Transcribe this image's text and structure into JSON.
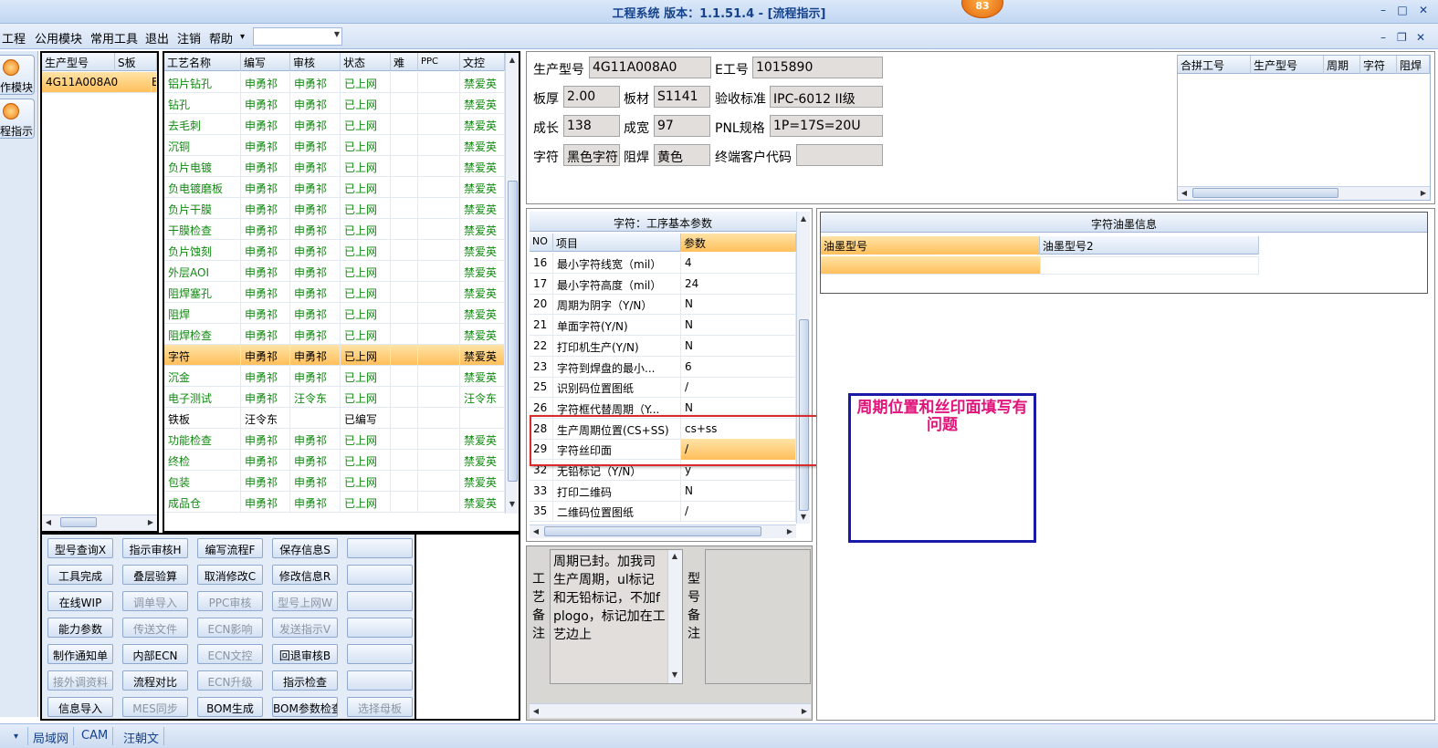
{
  "window": {
    "title": "工程系统  版本：1.1.51.4 - [流程指示]",
    "badge": "83",
    "min": "–",
    "max": "□",
    "close": "✕"
  },
  "menu": {
    "items": [
      "工程",
      "公用模块",
      "常用工具",
      "退出",
      "注销",
      "帮助"
    ],
    "help_arrow": "▾",
    "combo_value": "",
    "mdi_min": "–",
    "mdi_restore": "❐",
    "mdi_close": "✕"
  },
  "toolbox": {
    "items": [
      "作模块",
      "程指示"
    ]
  },
  "model_list": {
    "headers": [
      "生产型号",
      "S板"
    ],
    "rows": [
      [
        "4G11A008A0",
        "E"
      ]
    ]
  },
  "process_table": {
    "headers": [
      "工艺名称",
      "编写",
      "审核",
      "状态",
      "难",
      "PPC",
      "文控"
    ],
    "rows": [
      [
        "铝片钻孔",
        "申勇祁",
        "申勇祁",
        "已上网",
        "",
        "",
        "禁爱英"
      ],
      [
        "钻孔",
        "申勇祁",
        "申勇祁",
        "已上网",
        "",
        "",
        "禁爱英"
      ],
      [
        "去毛刺",
        "申勇祁",
        "申勇祁",
        "已上网",
        "",
        "",
        "禁爱英"
      ],
      [
        "沉铜",
        "申勇祁",
        "申勇祁",
        "已上网",
        "",
        "",
        "禁爱英"
      ],
      [
        "负片电镀",
        "申勇祁",
        "申勇祁",
        "已上网",
        "",
        "",
        "禁爱英"
      ],
      [
        "负电镀磨板",
        "申勇祁",
        "申勇祁",
        "已上网",
        "",
        "",
        "禁爱英"
      ],
      [
        "负片干膜",
        "申勇祁",
        "申勇祁",
        "已上网",
        "",
        "",
        "禁爱英"
      ],
      [
        "干膜检查",
        "申勇祁",
        "申勇祁",
        "已上网",
        "",
        "",
        "禁爱英"
      ],
      [
        "负片蚀刻",
        "申勇祁",
        "申勇祁",
        "已上网",
        "",
        "",
        "禁爱英"
      ],
      [
        "外层AOI",
        "申勇祁",
        "申勇祁",
        "已上网",
        "",
        "",
        "禁爱英"
      ],
      [
        "阻焊塞孔",
        "申勇祁",
        "申勇祁",
        "已上网",
        "",
        "",
        "禁爱英"
      ],
      [
        "阻焊",
        "申勇祁",
        "申勇祁",
        "已上网",
        "",
        "",
        "禁爱英"
      ],
      [
        "阻焊检查",
        "申勇祁",
        "申勇祁",
        "已上网",
        "",
        "",
        "禁爱英"
      ],
      [
        "字符",
        "申勇祁",
        "申勇祁",
        "已上网",
        "",
        "",
        "禁爱英"
      ],
      [
        "沉金",
        "申勇祁",
        "申勇祁",
        "已上网",
        "",
        "",
        "禁爱英"
      ],
      [
        "电子测试",
        "申勇祁",
        "汪令东",
        "已上网",
        "",
        "",
        "汪令东"
      ],
      [
        "铁板",
        "汪令东",
        "",
        "已编写",
        "",
        "",
        ""
      ],
      [
        "功能检查",
        "申勇祁",
        "申勇祁",
        "已上网",
        "",
        "",
        "禁爱英"
      ],
      [
        "终检",
        "申勇祁",
        "申勇祁",
        "已上网",
        "",
        "",
        "禁爱英"
      ],
      [
        "包装",
        "申勇祁",
        "申勇祁",
        "已上网",
        "",
        "",
        "禁爱英"
      ],
      [
        "成品仓",
        "申勇祁",
        "申勇祁",
        "已上网",
        "",
        "",
        "禁爱英"
      ]
    ],
    "selected_index": 13
  },
  "buttons": [
    [
      "型号查询X",
      "指示审核H",
      "编写流程F",
      "保存信息S",
      ""
    ],
    [
      "工具完成",
      "叠层验算",
      "取消修改C",
      "修改信息R",
      ""
    ],
    [
      "在线WIP",
      "调单导入",
      "PPC审核",
      "型号上网W",
      ""
    ],
    [
      "能力参数",
      "传送文件",
      "ECN影响",
      "发送指示V",
      ""
    ],
    [
      "制作通知单",
      "内部ECN",
      "ECN文控",
      "回退审核B",
      ""
    ],
    [
      "接外调资料",
      "流程对比",
      "ECN升级",
      "指示检查",
      ""
    ],
    [
      "信息导入",
      "MES同步",
      "BOM生成",
      "BOM参数检查",
      "选择母板"
    ]
  ],
  "buttons_disabled": [
    [
      false,
      false,
      false,
      false,
      false
    ],
    [
      false,
      false,
      false,
      false,
      false
    ],
    [
      false,
      true,
      true,
      true,
      false
    ],
    [
      false,
      true,
      true,
      true,
      false
    ],
    [
      false,
      false,
      true,
      false,
      false
    ],
    [
      true,
      false,
      true,
      false,
      false
    ],
    [
      false,
      true,
      false,
      false,
      true
    ]
  ],
  "info": {
    "labels": {
      "model": "生产型号",
      "eno": "E工号",
      "thickness": "板厚",
      "material": "板材",
      "standard": "验收标准",
      "length": "成长",
      "width": "成宽",
      "pnl": "PNL规格",
      "char": "字符",
      "mask": "阻焊",
      "customer": "终端客户代码"
    },
    "values": {
      "model": "4G11A008A0",
      "eno": "1015890",
      "thickness": "2.00",
      "material": "S1141",
      "standard": "IPC-6012 II级",
      "length": "138",
      "width": "97",
      "pnl": "1P=17S=20U",
      "char": "黑色字符",
      "mask": "黄色",
      "customer": ""
    }
  },
  "merge_table": {
    "headers": [
      "合拼工号",
      "生产型号",
      "周期",
      "字符",
      "阻焊"
    ]
  },
  "params": {
    "title": "字符：工序基本参数",
    "headers": [
      "NO",
      "项目",
      "参数"
    ],
    "rows": [
      [
        "16",
        "最小字符线宽（mil）",
        "4"
      ],
      [
        "17",
        "最小字符高度（mil）",
        "24"
      ],
      [
        "20",
        "周期为阴字（Y/N）",
        "N"
      ],
      [
        "21",
        "单面字符(Y/N)",
        "N"
      ],
      [
        "22",
        "打印机生产(Y/N)",
        "N"
      ],
      [
        "23",
        "字符到焊盘的最小...",
        "6"
      ],
      [
        "25",
        "识别码位置图纸",
        "/"
      ],
      [
        "26",
        "字符框代替周期（Y...",
        "N"
      ],
      [
        "28",
        "生产周期位置(CS+SS)",
        "cs+ss"
      ],
      [
        "29",
        "字符丝印面",
        "/"
      ],
      [
        "32",
        "无铅标记（Y/N）",
        "y"
      ],
      [
        "33",
        "打印二维码",
        "N"
      ],
      [
        "35",
        "二维码位置图纸",
        "/"
      ]
    ],
    "selected_index": 9
  },
  "ink": {
    "title": "字符油墨信息",
    "headers": [
      "油墨型号",
      "油墨型号2"
    ]
  },
  "notes": {
    "process_label": "工艺备注",
    "process_text": "周期已封。加我司生产周期，ul标记和无铅标记，不加fplogo，标记加在工艺边上",
    "model_label": "型号备注",
    "model_text": ""
  },
  "annotation": {
    "text": "周期位置和丝印面填写有问题",
    "color": "#e0147a",
    "border_color": "#1a1aa8",
    "highlight_color": "#d92b2b"
  },
  "status": {
    "items": [
      "局域网",
      "CAM",
      "汪朝文"
    ],
    "arrow": "▾"
  },
  "colors": {
    "selection": "#ffbf5b",
    "green_text": "#0f8a0f",
    "title_text": "#15428b"
  }
}
